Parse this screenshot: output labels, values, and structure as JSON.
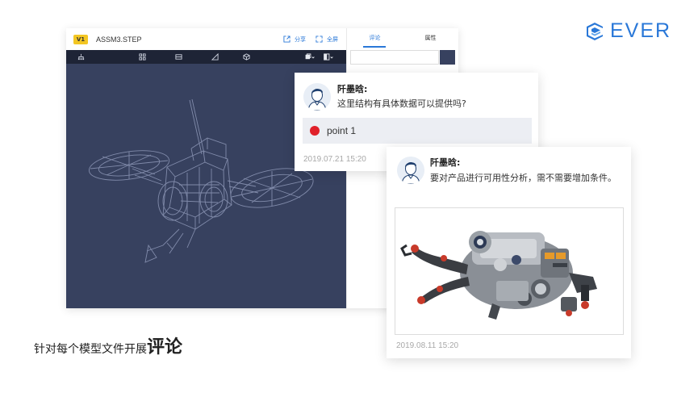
{
  "brand": {
    "name": "EVER",
    "color": "#2a78d8"
  },
  "viewer": {
    "version": "V1",
    "file_name": "ASSM3.STEP",
    "share_label": "分享",
    "fullscreen_label": "全屏",
    "toolbar_icons": [
      "tree-icon",
      "grid-icon",
      "section-icon",
      "measure-icon",
      "cube-icon",
      "display-mode-icon",
      "render-mode-icon"
    ]
  },
  "side_panel": {
    "tabs": [
      {
        "label": "评论",
        "active": true
      },
      {
        "label": "属性",
        "active": false
      }
    ]
  },
  "comments": [
    {
      "author": "阡墨晗:",
      "text": "这里结构有具体数据可以提供吗?",
      "point": "point 1",
      "time": "2019.07.21  15:20"
    },
    {
      "author": "阡墨晗:",
      "text": "要对产品进行可用性分析，需不需要增加条件。",
      "time": "2019.08.11  15:20"
    }
  ],
  "caption": {
    "normal": "针对每个模型文件开展",
    "bold": "评论"
  }
}
